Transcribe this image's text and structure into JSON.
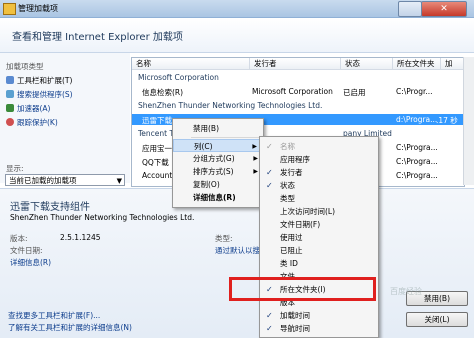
{
  "window": {
    "title": "管理加载项",
    "close_glyph": "✕",
    "header": "查看和管理 Internet Explorer 加载项"
  },
  "left_pane": {
    "types_label": "加载项类型",
    "items": [
      {
        "label": "工具栏和扩展(T)",
        "icon_color": "#5a8ad0"
      },
      {
        "label": "搜索提供程序(S)",
        "icon_color": "#5aa0d0"
      },
      {
        "label": "加速器(A)",
        "icon_color": "#3a8a3a"
      },
      {
        "label": "跟踪保护(K)",
        "icon_color": "#d05050"
      }
    ],
    "show_label": "显示:",
    "show_value": "当前已加载的加载项"
  },
  "list": {
    "columns": [
      "名称",
      "发行者",
      "状态",
      "所在文件夹",
      "加"
    ],
    "groups": [
      {
        "name": "Microsoft Corporation"
      },
      {
        "name": "ShenZhen Thunder Networking Technologies Ltd."
      },
      {
        "name": "Tencent T"
      }
    ],
    "rows": [
      {
        "name": "信息检索(R)",
        "publisher": "Microsoft Corporation",
        "status": "已启用",
        "folder": "C:\\Progr...",
        "load": ""
      },
      {
        "name": "迅雷下载",
        "publisher": "",
        "status": "",
        "folder": "d:\\Progra...",
        "load": ".17 秒"
      },
      {
        "name": "应用宝一",
        "publisher": "",
        "status": "",
        "folder": "C:\\Progra...",
        "load": ""
      },
      {
        "name": "QQ下载",
        "publisher": "",
        "status": "",
        "folder": "C:\\Progra...",
        "load": ""
      },
      {
        "name": "Account",
        "publisher": "",
        "status": "",
        "folder": "C:\\Progra...",
        "load": ""
      }
    ],
    "partial_publisher": "pany Limited"
  },
  "details": {
    "addon_name": "迅雷下载支持组件",
    "company": "ShenZhen Thunder Networking Technologies Ltd.",
    "version_label": "版本:",
    "version_value": "2.5.1.1245",
    "date_label": "文件日期:",
    "more_info": "详细信息(R)",
    "type_label": "类型:",
    "search_link": "通过默认以搜",
    "find_more": "查找更多工具栏和扩展(F)...",
    "learn_more": "了解有关工具栏和扩展的详细信息(N)",
    "disable_button": "禁用(B)",
    "close_button": "关闭(L)"
  },
  "context_menu": [
    {
      "label": "禁用(B)",
      "bold": false,
      "submenu": false,
      "highlight": false
    },
    {
      "label": "列(C)",
      "bold": false,
      "submenu": true,
      "highlight": true
    },
    {
      "label": "分组方式(G)",
      "bold": false,
      "submenu": true,
      "highlight": false
    },
    {
      "label": "排序方式(S)",
      "bold": false,
      "submenu": true,
      "highlight": false
    },
    {
      "label": "复制(O)",
      "bold": false,
      "submenu": false,
      "highlight": false
    },
    {
      "label": "详细信息(R)",
      "bold": true,
      "submenu": false,
      "highlight": false
    }
  ],
  "columns_submenu": [
    {
      "label": "名称",
      "checked": true,
      "disabled": true
    },
    {
      "label": "应用程序",
      "checked": false
    },
    {
      "label": "发行者",
      "checked": true
    },
    {
      "label": "状态",
      "checked": true
    },
    {
      "label": "类型",
      "checked": false
    },
    {
      "label": "上次访问时间(L)",
      "checked": false
    },
    {
      "label": "文件日期(F)",
      "checked": false
    },
    {
      "label": "使用过",
      "checked": false
    },
    {
      "label": "已阻止",
      "checked": false
    },
    {
      "label": "类 ID",
      "checked": false
    },
    {
      "label": "文件",
      "checked": false
    },
    {
      "label": "所在文件夹(I)",
      "checked": true
    },
    {
      "label": "版本",
      "checked": false
    },
    {
      "label": "加载时间",
      "checked": true
    },
    {
      "label": "导航时间",
      "checked": true
    }
  ],
  "watermark": "百度经验",
  "colors": {
    "accent": "#3399ff",
    "highlight_box": "#e0201e"
  }
}
